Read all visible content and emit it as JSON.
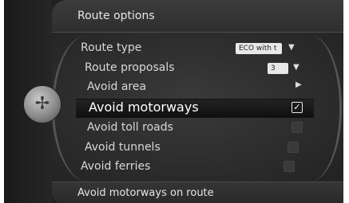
{
  "header": {
    "title": "Route options"
  },
  "menu": {
    "items": [
      {
        "label": "Route type",
        "value": "ECO with t"
      },
      {
        "label": "Route proposals",
        "value": "3"
      },
      {
        "label": "Avoid area"
      },
      {
        "label": "Avoid motorways",
        "checked": true
      },
      {
        "label": "Avoid toll roads",
        "checked": false
      },
      {
        "label": "Avoid tunnels",
        "checked": false
      },
      {
        "label": "Avoid ferries",
        "checked": false
      }
    ]
  },
  "footer": {
    "text": "Avoid motorways on route"
  },
  "icons": {
    "knob": "compass-icon",
    "dropdown": "triangle-down-icon",
    "submenu": "triangle-right-icon",
    "check": "checkmark-icon"
  }
}
